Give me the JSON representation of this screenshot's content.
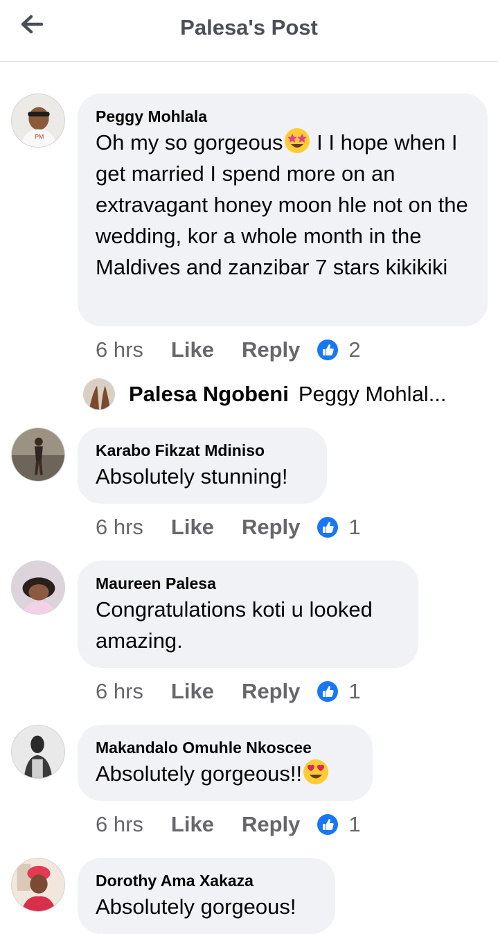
{
  "header": {
    "title": "Palesa's Post"
  },
  "comments": [
    {
      "author": "Peggy Mohlala",
      "text_before_emoji": "Oh my so gorgeous",
      "emoji": "star-struck",
      "text_after_emoji": " I I hope when I get married I spend more on an extravagant honey moon hle not on the wedding, kor a whole month in the Maldives and zanzibar 7 stars kikikiki",
      "time": "6 hrs",
      "like_label": "Like",
      "reply_label": "Reply",
      "reaction_count": "2"
    },
    {
      "author": "Karabo Fikzat Mdiniso",
      "text": "Absolutely stunning!",
      "time": "6 hrs",
      "like_label": "Like",
      "reply_label": "Reply",
      "reaction_count": "1"
    },
    {
      "author": "Maureen Palesa",
      "text": "Congratulations koti u looked amazing.",
      "time": "6 hrs",
      "like_label": "Like",
      "reply_label": "Reply",
      "reaction_count": "1"
    },
    {
      "author": "Makandalo Omuhle Nkoscee",
      "text": "Absolutely gorgeous!!",
      "emoji": "heart-eyes",
      "time": "6 hrs",
      "like_label": "Like",
      "reply_label": "Reply",
      "reaction_count": "1"
    },
    {
      "author": "Dorothy Ama Xakaza",
      "text": "Absolutely gorgeous!"
    }
  ],
  "reply_preview": {
    "author": "Palesa Ngobeni",
    "snippet": "Peggy Mohlal..."
  },
  "colors": {
    "like_blue": "#1877f2",
    "bubble": "#f0f2f5",
    "meta": "#65676b"
  }
}
